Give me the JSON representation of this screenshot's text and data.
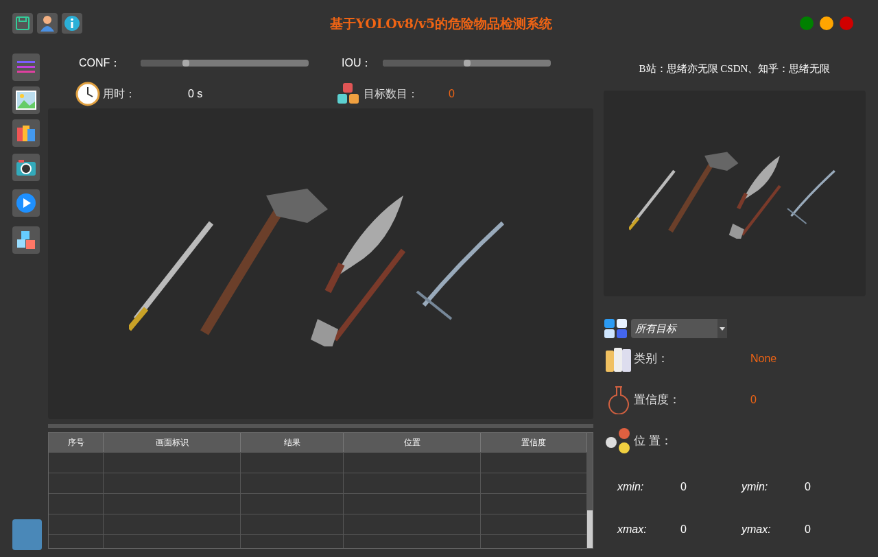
{
  "title": "基于YOLOv8/v5的危险物品检测系统",
  "credit": "B站：思绪亦无限  CSDN、知乎：思绪无限",
  "sliders": [
    {
      "label": "CONF：",
      "level": 0.27
    },
    {
      "label": "IOU：",
      "level": 0.5
    }
  ],
  "stats": [
    {
      "kind": "time",
      "label": "用时：",
      "value": "0 s"
    },
    {
      "kind": "count",
      "label": "目标数目：",
      "value": "0"
    }
  ],
  "table": {
    "columns": [
      "序号",
      "画面标识",
      "结果",
      "位置",
      "置信度"
    ]
  },
  "target_select": {
    "value": "所有目标"
  },
  "details": [
    {
      "kind": "category",
      "label": "类别：",
      "value": "None"
    },
    {
      "kind": "confidence",
      "label": "置信度：",
      "value": "0"
    },
    {
      "kind": "position",
      "label": "位 置："
    }
  ],
  "coords": [
    {
      "label": "xmin:",
      "value": "0"
    },
    {
      "label": "ymin:",
      "value": "0"
    },
    {
      "label": "xmax:",
      "value": "0"
    },
    {
      "label": "ymax:",
      "value": "0"
    }
  ]
}
